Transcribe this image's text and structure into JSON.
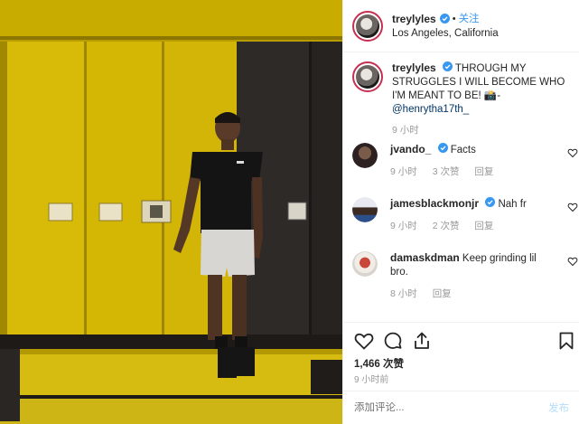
{
  "post": {
    "username": "treylyles",
    "follow_label": "关注",
    "location": "Los Angeles, California",
    "caption": {
      "username": "treylyles",
      "text": "THROUGH MY STRUGGLES I WILL BECOME WHO I'M MEANT TO BE! 📸-",
      "mention": "@henrytha17th_",
      "time": "9 小时"
    },
    "comments": [
      {
        "username": "jvando_",
        "text": "Facts",
        "time": "9 小时",
        "likes": "3 次赞",
        "reply": "回复"
      },
      {
        "username": "jamesblackmonjr",
        "text": "Nah fr",
        "time": "9 小时",
        "likes": "2 次赞",
        "reply": "回复"
      },
      {
        "username": "damaskdman",
        "text": "Keep grinding lil bro.",
        "time": "8 小时",
        "reply": "回复"
      }
    ],
    "like_count": "1,466 次赞",
    "post_time": "9 小时前",
    "add_comment_placeholder": "添加评论...",
    "post_button": "发布"
  },
  "colors": {
    "accent": "#3897f0",
    "verified": "#3897f0",
    "story_ring": "#c72f52",
    "locker_yellow": "#d4b600",
    "locker_dark": "#2b2827"
  },
  "icons": [
    "verified-icon",
    "heart-icon",
    "comment-icon",
    "share-icon",
    "bookmark-icon"
  ]
}
